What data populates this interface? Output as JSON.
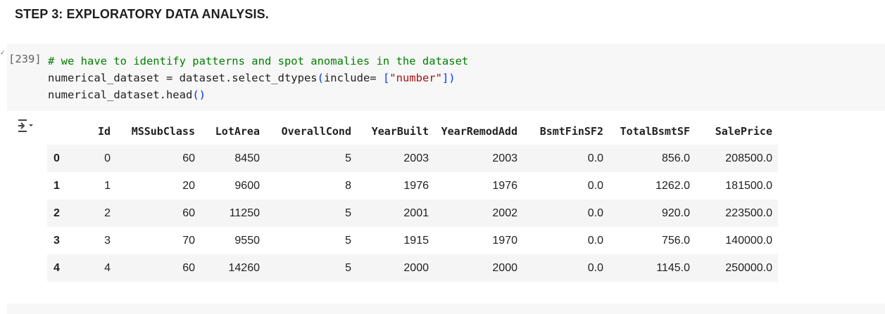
{
  "heading": "STEP 3: EXPLORATORY DATA ANALYSIS.",
  "cell": {
    "execution_count": "[239]",
    "code_lines": [
      {
        "parts": [
          {
            "cls": "c-comment",
            "text": "# we have to identify patterns and spot anomalies in the dataset"
          }
        ]
      },
      {
        "parts": [
          {
            "cls": "",
            "text": "numerical_dataset = dataset.select_dtypes"
          },
          {
            "cls": "c-paren",
            "text": "("
          },
          {
            "cls": "",
            "text": "include= "
          },
          {
            "cls": "c-paren",
            "text": "["
          },
          {
            "cls": "c-string",
            "text": "\"number\""
          },
          {
            "cls": "c-paren",
            "text": "]"
          },
          {
            "cls": "c-paren",
            "text": ")"
          }
        ]
      },
      {
        "parts": [
          {
            "cls": "",
            "text": "numerical_dataset.head"
          },
          {
            "cls": "c-paren",
            "text": "()"
          }
        ]
      }
    ]
  },
  "output": {
    "icon": "output-toggle-icon",
    "table": {
      "columns": [
        "",
        "Id",
        "MSSubClass",
        "LotArea",
        "OverallCond",
        "YearBuilt",
        "YearRemodAdd",
        "BsmtFinSF2",
        "TotalBsmtSF",
        "SalePrice"
      ],
      "rows": [
        {
          "index": "0",
          "cells": [
            "0",
            "60",
            "8450",
            "5",
            "2003",
            "2003",
            "0.0",
            "856.0",
            "208500.0"
          ]
        },
        {
          "index": "1",
          "cells": [
            "1",
            "20",
            "9600",
            "8",
            "1976",
            "1976",
            "0.0",
            "1262.0",
            "181500.0"
          ]
        },
        {
          "index": "2",
          "cells": [
            "2",
            "60",
            "11250",
            "5",
            "2001",
            "2002",
            "0.0",
            "920.0",
            "223500.0"
          ]
        },
        {
          "index": "3",
          "cells": [
            "3",
            "70",
            "9550",
            "5",
            "1915",
            "1970",
            "0.0",
            "756.0",
            "140000.0"
          ]
        },
        {
          "index": "4",
          "cells": [
            "4",
            "60",
            "14260",
            "5",
            "2000",
            "2000",
            "0.0",
            "1145.0",
            "250000.0"
          ]
        }
      ]
    }
  }
}
